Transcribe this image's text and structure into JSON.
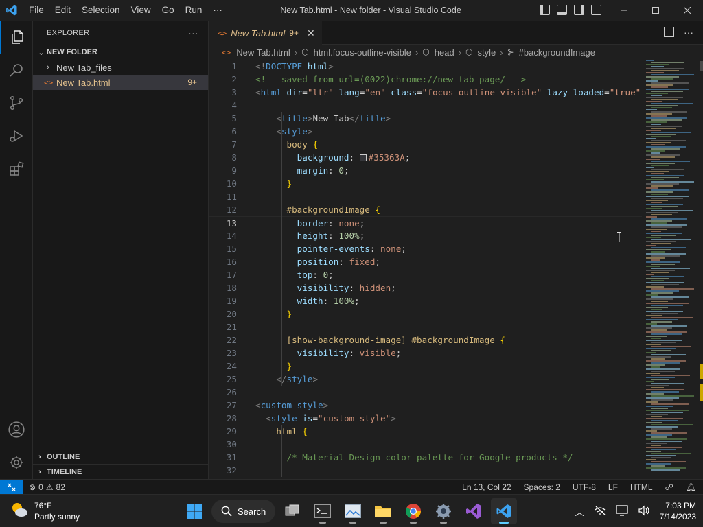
{
  "window": {
    "title": "New Tab.html - New folder - Visual Studio Code"
  },
  "menu": [
    "File",
    "Edit",
    "Selection",
    "View",
    "Go",
    "Run",
    "···"
  ],
  "explorer": {
    "header": "EXPLORER",
    "more": "···",
    "folder": "NEW FOLDER",
    "items": [
      {
        "name": "New Tab_files",
        "type": "folder"
      },
      {
        "name": "New Tab.html",
        "type": "file",
        "badge": "9+"
      }
    ],
    "panels": [
      "OUTLINE",
      "TIMELINE"
    ]
  },
  "tab": {
    "name": "New Tab.html",
    "badge": "9+"
  },
  "breadcrumb": [
    "New Tab.html",
    "html.focus-outline-visible",
    "head",
    "style",
    "#backgroundImage"
  ],
  "code": {
    "current_line": 13,
    "lines": [
      [
        [
          "t-pun",
          "<!"
        ],
        [
          "t-tag",
          "DOCTYPE"
        ],
        [
          "t-txt",
          " "
        ],
        [
          "t-attr",
          "html"
        ],
        [
          "t-pun",
          ">"
        ]
      ],
      [
        [
          "t-com",
          "<!-- saved from url=(0022)chrome://new-tab-page/ -->"
        ]
      ],
      [
        [
          "t-pun",
          "<"
        ],
        [
          "t-tag",
          "html"
        ],
        [
          "t-txt",
          " "
        ],
        [
          "t-attr",
          "dir"
        ],
        [
          "t-txt",
          "="
        ],
        [
          "t-str",
          "\"ltr\""
        ],
        [
          "t-txt",
          " "
        ],
        [
          "t-attr",
          "lang"
        ],
        [
          "t-txt",
          "="
        ],
        [
          "t-str",
          "\"en\""
        ],
        [
          "t-txt",
          " "
        ],
        [
          "t-attr",
          "class"
        ],
        [
          "t-txt",
          "="
        ],
        [
          "t-str",
          "\"focus-outline-visible\""
        ],
        [
          "t-txt",
          " "
        ],
        [
          "t-attr",
          "lazy-loaded"
        ],
        [
          "t-txt",
          "="
        ],
        [
          "t-str",
          "\"true\""
        ]
      ],
      [],
      [
        [
          "t-txt",
          "    "
        ],
        [
          "t-pun",
          "<"
        ],
        [
          "t-tag",
          "title"
        ],
        [
          "t-pun",
          ">"
        ],
        [
          "t-txt",
          "New Tab"
        ],
        [
          "t-pun",
          "</"
        ],
        [
          "t-tag",
          "title"
        ],
        [
          "t-pun",
          ">"
        ]
      ],
      [
        [
          "t-txt",
          "    "
        ],
        [
          "t-pun",
          "<"
        ],
        [
          "t-tag",
          "style"
        ],
        [
          "t-pun",
          ">"
        ]
      ],
      [
        [
          "t-txt",
          "      "
        ],
        [
          "t-sel",
          "body"
        ],
        [
          "t-txt",
          " "
        ],
        [
          "t-br",
          "{"
        ]
      ],
      [
        [
          "t-txt",
          "        "
        ],
        [
          "t-prop",
          "background"
        ],
        [
          "t-txt",
          ": "
        ],
        [
          "t-swatch",
          "#35363A"
        ],
        [
          "t-val",
          "#35363A"
        ],
        [
          "t-txt",
          ";"
        ]
      ],
      [
        [
          "t-txt",
          "        "
        ],
        [
          "t-prop",
          "margin"
        ],
        [
          "t-txt",
          ": "
        ],
        [
          "t-num",
          "0"
        ],
        [
          "t-txt",
          ";"
        ]
      ],
      [
        [
          "t-txt",
          "      "
        ],
        [
          "t-br",
          "}"
        ]
      ],
      [],
      [
        [
          "t-txt",
          "      "
        ],
        [
          "t-sel",
          "#backgroundImage"
        ],
        [
          "t-txt",
          " "
        ],
        [
          "t-br",
          "{"
        ]
      ],
      [
        [
          "t-txt",
          "        "
        ],
        [
          "t-prop",
          "border"
        ],
        [
          "t-txt",
          ": "
        ],
        [
          "t-val",
          "none"
        ],
        [
          "t-txt",
          ";"
        ]
      ],
      [
        [
          "t-txt",
          "        "
        ],
        [
          "t-prop",
          "height"
        ],
        [
          "t-txt",
          ": "
        ],
        [
          "t-num",
          "100%"
        ],
        [
          "t-txt",
          ";"
        ]
      ],
      [
        [
          "t-txt",
          "        "
        ],
        [
          "t-prop",
          "pointer-events"
        ],
        [
          "t-txt",
          ": "
        ],
        [
          "t-val",
          "none"
        ],
        [
          "t-txt",
          ";"
        ]
      ],
      [
        [
          "t-txt",
          "        "
        ],
        [
          "t-prop",
          "position"
        ],
        [
          "t-txt",
          ": "
        ],
        [
          "t-val",
          "fixed"
        ],
        [
          "t-txt",
          ";"
        ]
      ],
      [
        [
          "t-txt",
          "        "
        ],
        [
          "t-prop",
          "top"
        ],
        [
          "t-txt",
          ": "
        ],
        [
          "t-num",
          "0"
        ],
        [
          "t-txt",
          ";"
        ]
      ],
      [
        [
          "t-txt",
          "        "
        ],
        [
          "t-prop",
          "visibility"
        ],
        [
          "t-txt",
          ": "
        ],
        [
          "t-val",
          "hidden"
        ],
        [
          "t-txt",
          ";"
        ]
      ],
      [
        [
          "t-txt",
          "        "
        ],
        [
          "t-prop",
          "width"
        ],
        [
          "t-txt",
          ": "
        ],
        [
          "t-num",
          "100%"
        ],
        [
          "t-txt",
          ";"
        ]
      ],
      [
        [
          "t-txt",
          "      "
        ],
        [
          "t-br",
          "}"
        ]
      ],
      [],
      [
        [
          "t-txt",
          "      "
        ],
        [
          "t-sel",
          "[show-background-image] #backgroundImage"
        ],
        [
          "t-txt",
          " "
        ],
        [
          "t-br",
          "{"
        ]
      ],
      [
        [
          "t-txt",
          "        "
        ],
        [
          "t-prop",
          "visibility"
        ],
        [
          "t-txt",
          ": "
        ],
        [
          "t-val",
          "visible"
        ],
        [
          "t-txt",
          ";"
        ]
      ],
      [
        [
          "t-txt",
          "      "
        ],
        [
          "t-br",
          "}"
        ]
      ],
      [
        [
          "t-txt",
          "    "
        ],
        [
          "t-pun",
          "</"
        ],
        [
          "t-tag",
          "style"
        ],
        [
          "t-pun",
          ">"
        ]
      ],
      [],
      [
        [
          "t-pun",
          "<"
        ],
        [
          "t-tag",
          "custom-style"
        ],
        [
          "t-pun",
          ">"
        ]
      ],
      [
        [
          "t-txt",
          "  "
        ],
        [
          "t-pun",
          "<"
        ],
        [
          "t-tag",
          "style"
        ],
        [
          "t-txt",
          " "
        ],
        [
          "t-attr",
          "is"
        ],
        [
          "t-txt",
          "="
        ],
        [
          "t-str",
          "\"custom-style\""
        ],
        [
          "t-pun",
          ">"
        ]
      ],
      [
        [
          "t-txt",
          "    "
        ],
        [
          "t-sel",
          "html"
        ],
        [
          "t-txt",
          " "
        ],
        [
          "t-br",
          "{"
        ]
      ],
      [],
      [
        [
          "t-txt",
          "      "
        ],
        [
          "t-com",
          "/* Material Design color palette for Google products */"
        ]
      ],
      []
    ]
  },
  "status": {
    "errors": "0",
    "warnings": "82",
    "position": "Ln 13, Col 22",
    "spaces": "Spaces: 2",
    "encoding": "UTF-8",
    "eol": "LF",
    "language": "HTML"
  },
  "taskbar": {
    "temp": "76°F",
    "weather": "Partly sunny",
    "search": "Search",
    "time": "7:03 PM",
    "date": "7/14/2023"
  },
  "colors": {
    "accent": "#0078d4",
    "modified": "#e2c08d",
    "swatch": "#35363A"
  }
}
